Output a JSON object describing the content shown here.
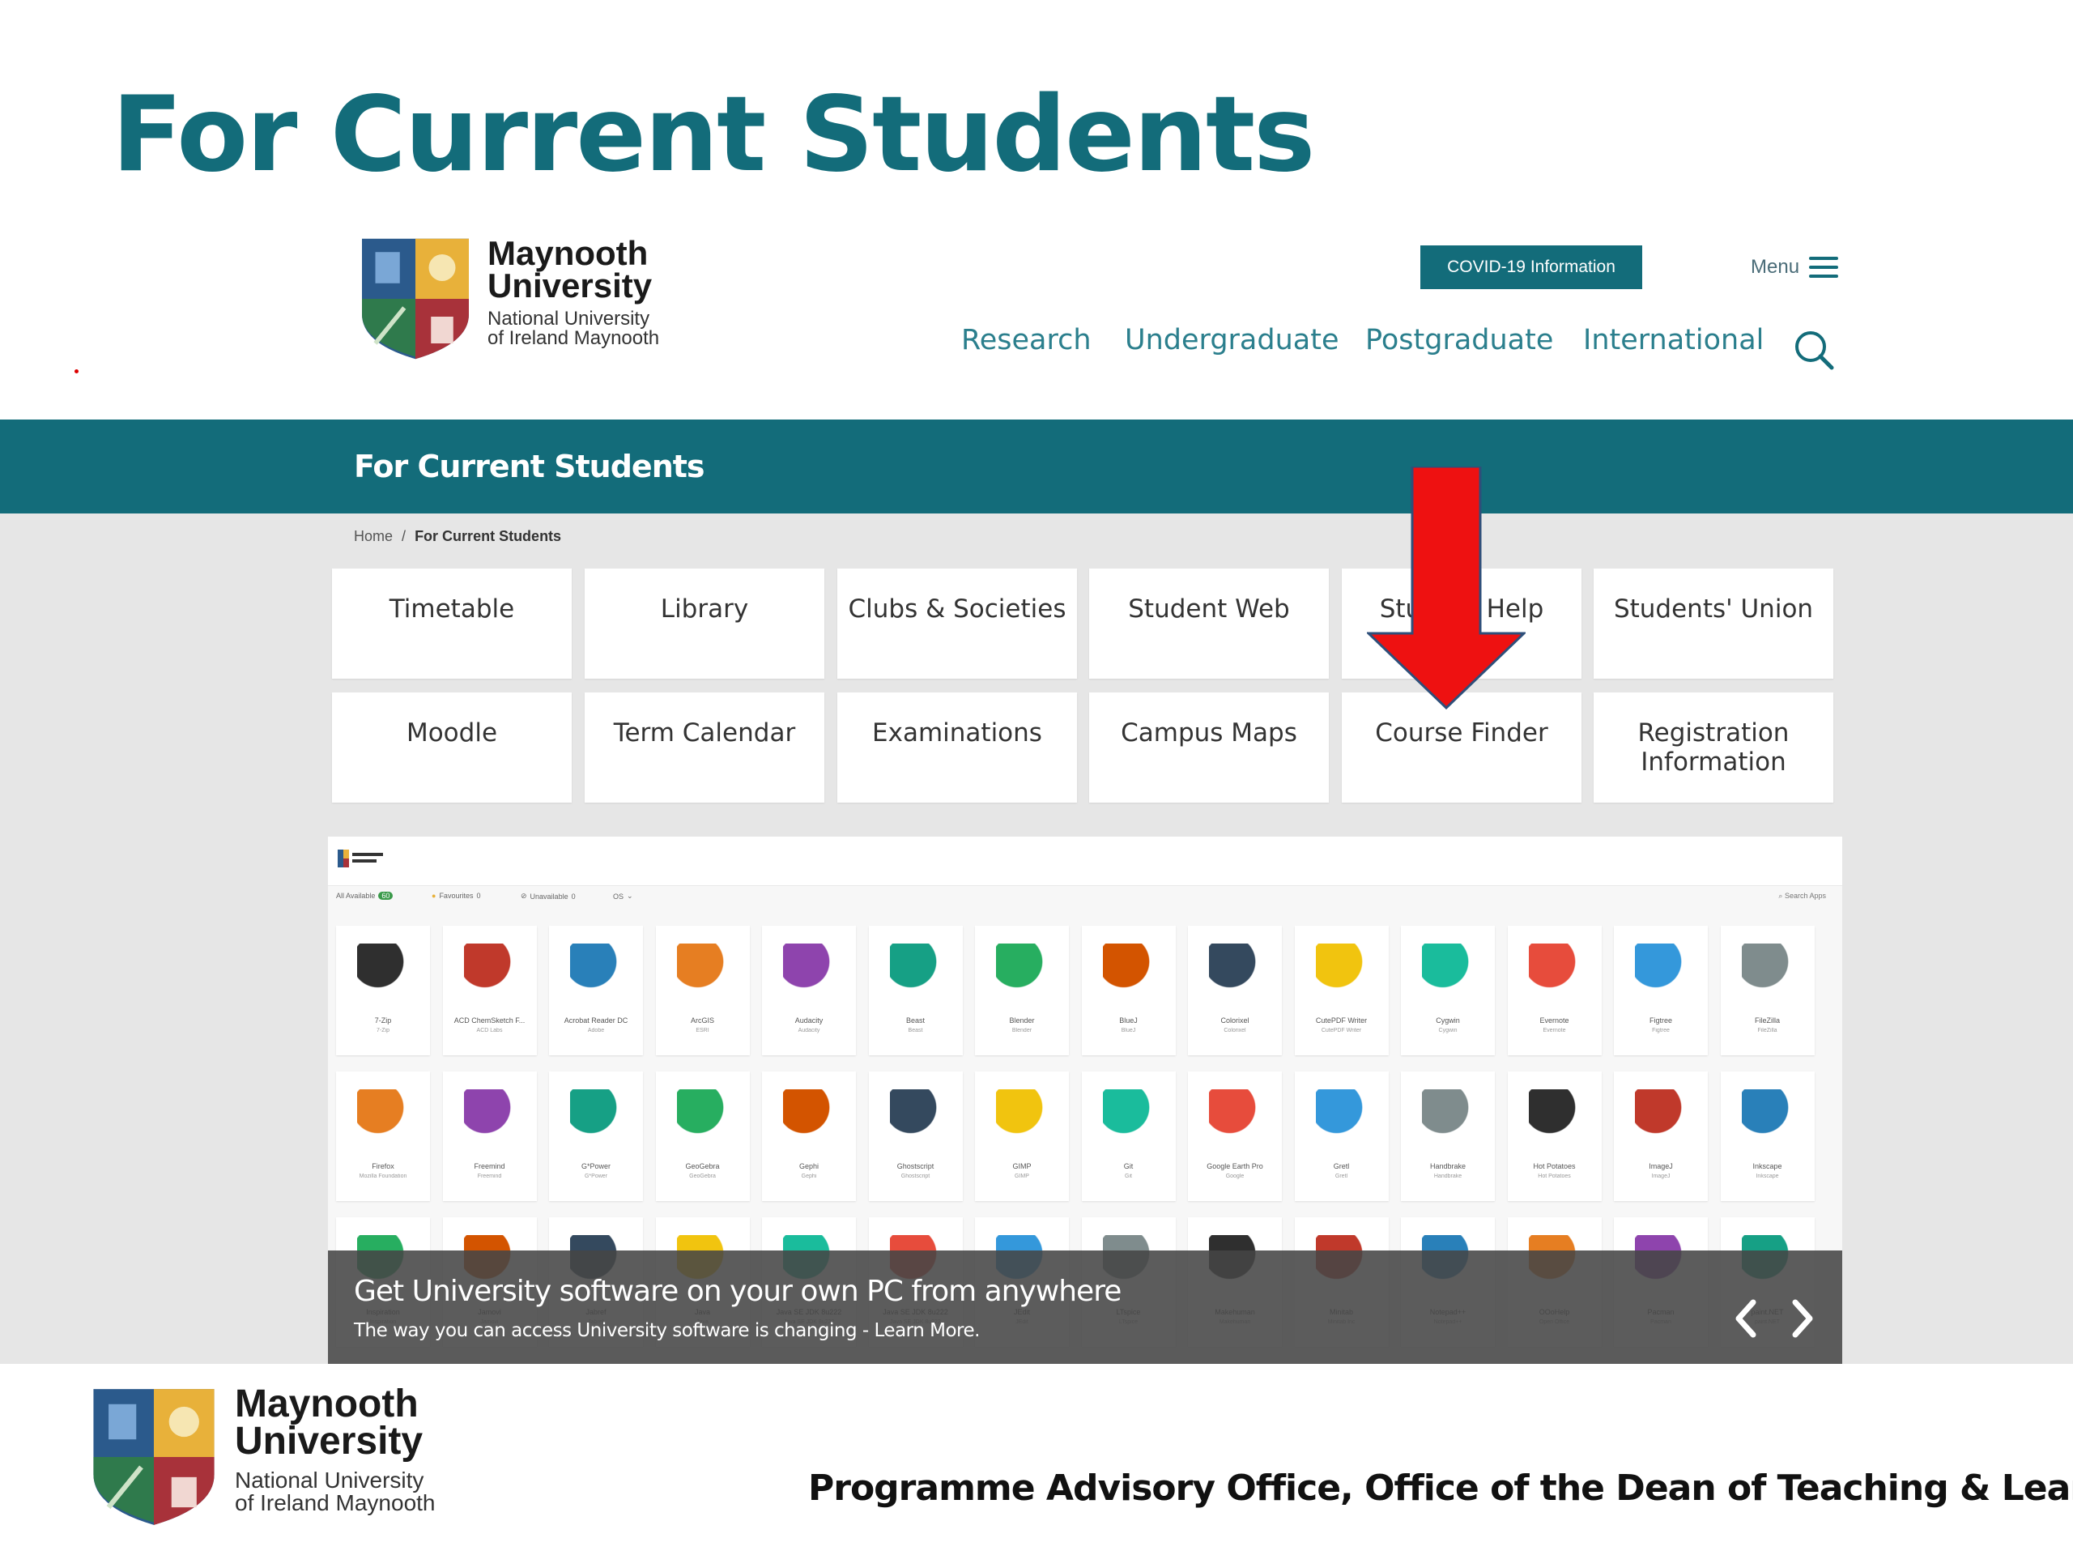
{
  "slide": {
    "title": "For Current Students",
    "footer": "Programme Advisory Office, Office of the Dean of Teaching & Learning"
  },
  "site": {
    "logo": {
      "name_line1": "Maynooth",
      "name_line2": "University",
      "sub_line1": "National University",
      "sub_line2": "of Ireland Maynooth"
    },
    "covid_button": "COVID-19 Information",
    "menu_label": "Menu",
    "nav": [
      "Research",
      "Undergraduate",
      "Postgraduate",
      "International"
    ],
    "banner_title": "For Current Students",
    "breadcrumb": {
      "home": "Home",
      "separator": "/",
      "current": "For Current Students"
    },
    "tiles": [
      "Timetable",
      "Library",
      "Clubs & Societies",
      "Student Web",
      "Student Help",
      "Students' Union",
      "Moodle",
      "Term Calendar",
      "Examinations",
      "Campus Maps",
      "Course Finder",
      "Registration Information"
    ],
    "brand_color": "#136c7a",
    "arrow_color": "#ee1111"
  },
  "apps_panel": {
    "filters": {
      "all": "All Available",
      "all_count": "60",
      "favourites": "Favourites",
      "fav_count": "0",
      "unavailable": "Unavailable",
      "unavail_count": "0",
      "os": "OS"
    },
    "search_placeholder": "Search Apps",
    "row1": [
      {
        "name": "7-Zip",
        "pub": "7-Zip"
      },
      {
        "name": "ACD ChemSketch F...",
        "pub": "ACD Labs"
      },
      {
        "name": "Acrobat Reader DC",
        "pub": "Adobe"
      },
      {
        "name": "ArcGIS",
        "pub": "ESRI"
      },
      {
        "name": "Audacity",
        "pub": "Audacity"
      },
      {
        "name": "Beast",
        "pub": "Beast"
      },
      {
        "name": "Blender",
        "pub": "Blender"
      },
      {
        "name": "BlueJ",
        "pub": "BlueJ"
      },
      {
        "name": "Colorixel",
        "pub": "Colorixel"
      },
      {
        "name": "CutePDF Writer",
        "pub": "CutePDF Writer"
      },
      {
        "name": "Cygwin",
        "pub": "Cygwin"
      },
      {
        "name": "Evernote",
        "pub": "Evernote"
      },
      {
        "name": "Figtree",
        "pub": "Figtree"
      },
      {
        "name": "FileZilla",
        "pub": "FileZilla"
      }
    ],
    "row2": [
      {
        "name": "Firefox",
        "pub": "Mozilla Foundation"
      },
      {
        "name": "Freemind",
        "pub": "Freemind"
      },
      {
        "name": "G*Power",
        "pub": "G*Power"
      },
      {
        "name": "GeoGebra",
        "pub": "GeoGebra"
      },
      {
        "name": "Gephi",
        "pub": "Gephi"
      },
      {
        "name": "Ghostscript",
        "pub": "Ghostscript"
      },
      {
        "name": "GIMP",
        "pub": "GIMP"
      },
      {
        "name": "Git",
        "pub": "Git"
      },
      {
        "name": "Google Earth Pro",
        "pub": "Google"
      },
      {
        "name": "Gretl",
        "pub": "Gretl"
      },
      {
        "name": "Handbrake",
        "pub": "Handbrake"
      },
      {
        "name": "Hot Potatoes",
        "pub": "Hot Potatoes"
      },
      {
        "name": "ImageJ",
        "pub": "ImageJ"
      },
      {
        "name": "Inkscape",
        "pub": "Inkscape"
      }
    ],
    "row3": [
      {
        "name": "Inspiration",
        "pub": "Inspiration"
      },
      {
        "name": "Jamovi",
        "pub": "Jamovi"
      },
      {
        "name": "Jabref",
        "pub": "Jabref"
      },
      {
        "name": "Java",
        "pub": "Java"
      },
      {
        "name": "Java SE JDK 8u222",
        "pub": "Java SE JDK 8u222"
      },
      {
        "name": "Java SE JDK 8u222",
        "pub": "Java SE JDK 8u222"
      },
      {
        "name": "JEdit",
        "pub": "JEdit"
      },
      {
        "name": "LTspice",
        "pub": "LTspice"
      },
      {
        "name": "Makehuman",
        "pub": "Makehuman"
      },
      {
        "name": "Minitab",
        "pub": "Minitab Inc"
      },
      {
        "name": "Notepad++",
        "pub": "Notepad++"
      },
      {
        "name": "OOoHelp",
        "pub": "Open Office"
      },
      {
        "name": "Pacman",
        "pub": "Pacman"
      },
      {
        "name": "paint.NET",
        "pub": "paint.NET"
      }
    ],
    "caption_title": "Get University software on your own PC from anywhere",
    "caption_sub": "The way you can access University software is changing - Learn More."
  }
}
